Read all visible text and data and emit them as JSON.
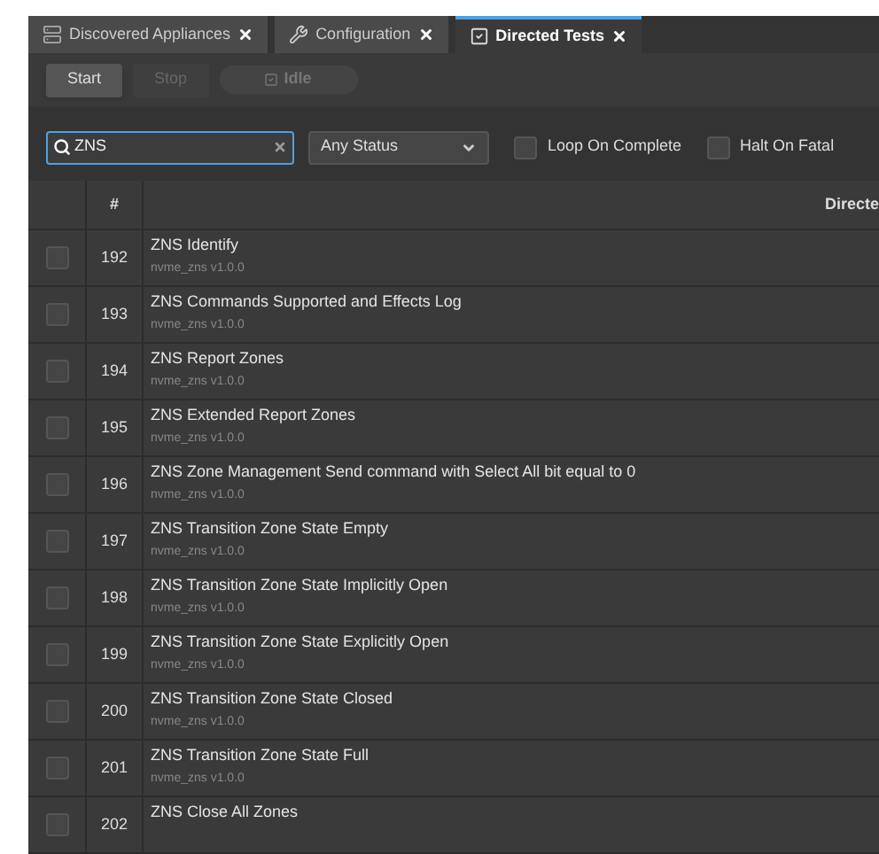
{
  "tabs": [
    {
      "label": "Discovered Appliances",
      "kind": "appliance",
      "selected": false
    },
    {
      "label": "Configuration",
      "kind": "wrench",
      "selected": false
    },
    {
      "label": "Directed Tests",
      "kind": "checkbox",
      "selected": true
    }
  ],
  "toolbar": {
    "buttons": [
      {
        "label": "Start",
        "disabled": false
      },
      {
        "label": "Stop",
        "disabled": true
      }
    ],
    "status": {
      "label": "Idle",
      "disabled": true
    }
  },
  "filter": {
    "search": {
      "value": "ZNS"
    },
    "status_select": {
      "value": "Any Status"
    },
    "options": [
      {
        "label": "Loop On Complete",
        "checked": false
      },
      {
        "label": "Halt On Fatal",
        "checked": false
      }
    ]
  },
  "table": {
    "columns": [
      {
        "label": "#"
      },
      {
        "label": "Directe"
      }
    ],
    "rows": [
      {
        "number": "192",
        "name": "ZNS Identify",
        "module": "nvme_zns v1.0.0",
        "checked": false
      },
      {
        "number": "193",
        "name": "ZNS Commands Supported and Effects Log",
        "module": "nvme_zns v1.0.0",
        "checked": false
      },
      {
        "number": "194",
        "name": "ZNS Report Zones",
        "module": "nvme_zns v1.0.0",
        "checked": false
      },
      {
        "number": "195",
        "name": "ZNS Extended Report Zones",
        "module": "nvme_zns v1.0.0",
        "checked": false
      },
      {
        "number": "196",
        "name": "ZNS Zone Management Send command with Select All bit equal to 0",
        "module": "nvme_zns v1.0.0",
        "checked": false
      },
      {
        "number": "197",
        "name": "ZNS Transition Zone State Empty",
        "module": "nvme_zns v1.0.0",
        "checked": false
      },
      {
        "number": "198",
        "name": "ZNS Transition Zone State Implicitly Open",
        "module": "nvme_zns v1.0.0",
        "checked": false
      },
      {
        "number": "199",
        "name": "ZNS Transition Zone State Explicitly Open",
        "module": "nvme_zns v1.0.0",
        "checked": false
      },
      {
        "number": "200",
        "name": "ZNS Transition Zone State Closed",
        "module": "nvme_zns v1.0.0",
        "checked": false
      },
      {
        "number": "201",
        "name": "ZNS Transition Zone State Full",
        "module": "nvme_zns v1.0.0",
        "checked": false
      },
      {
        "number": "202",
        "name": "ZNS Close All Zones",
        "checked": false
      }
    ]
  }
}
